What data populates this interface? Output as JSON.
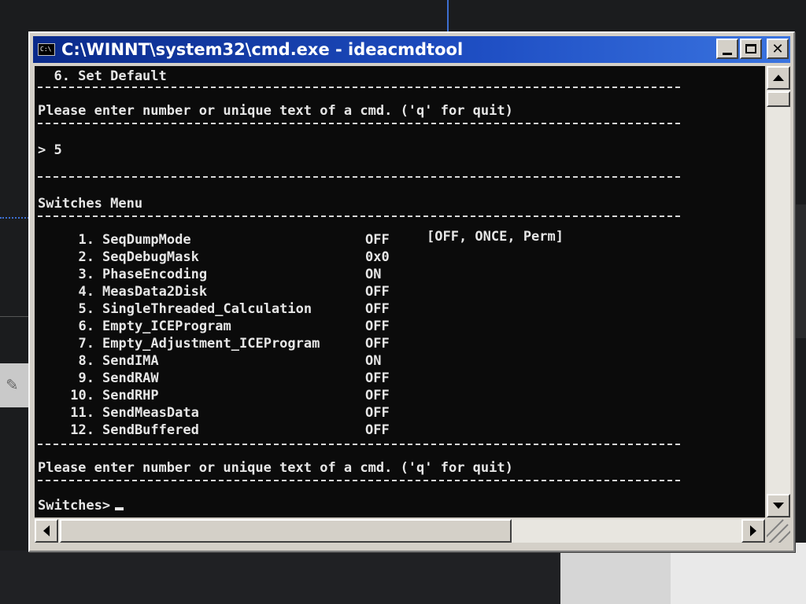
{
  "window": {
    "title": "C:\\WINNT\\system32\\cmd.exe - ideacmdtool",
    "icon": "console-icon",
    "icon_text": "C:\\"
  },
  "console": {
    "top_item": "  6. Set Default",
    "prompt_line_1": "Please enter number or unique text of a cmd. ('q' for quit)",
    "input_line": "> 5",
    "menu_title": "Switches Menu",
    "switches": [
      {
        "num": "1.",
        "name": "SeqDumpMode",
        "value": "OFF"
      },
      {
        "num": "2.",
        "name": "SeqDebugMask",
        "value": "0x0"
      },
      {
        "num": "3.",
        "name": "PhaseEncoding",
        "value": "ON"
      },
      {
        "num": "4.",
        "name": "MeasData2Disk",
        "value": "OFF"
      },
      {
        "num": "5.",
        "name": "SingleThreaded_Calculation",
        "value": "OFF"
      },
      {
        "num": "6.",
        "name": "Empty_ICEProgram",
        "value": "OFF"
      },
      {
        "num": "7.",
        "name": "Empty_Adjustment_ICEProgram",
        "value": "OFF"
      },
      {
        "num": "8.",
        "name": "SendIMA",
        "value": "ON"
      },
      {
        "num": "9.",
        "name": "SendRAW",
        "value": "OFF"
      },
      {
        "num": "10.",
        "name": "SendRHP",
        "value": "OFF"
      },
      {
        "num": "11.",
        "name": "SendMeasData",
        "value": "OFF"
      },
      {
        "num": "12.",
        "name": "SendBuffered",
        "value": "OFF"
      }
    ],
    "seqdump_options": "[OFF, ONCE, Perm]",
    "prompt_line_2": "Please enter number or unique text of a cmd. ('q' for quit)",
    "current_prompt": "Switches>"
  },
  "colors": {
    "titlebar": "#1f4fc4",
    "console_bg": "#0b0b0b",
    "console_fg": "#e6e6e6",
    "chrome": "#d4d0c8"
  }
}
